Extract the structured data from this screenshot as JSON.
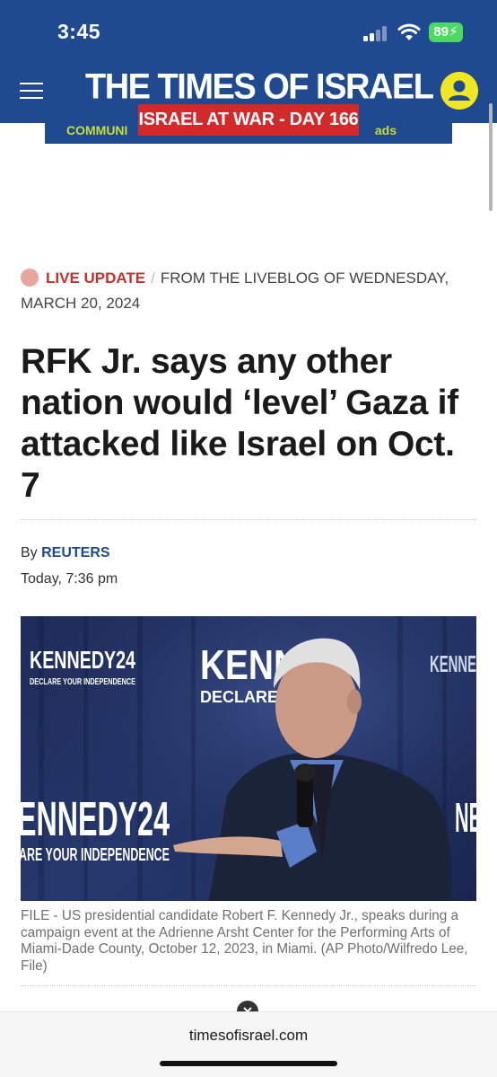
{
  "status_bar": {
    "time": "3:45",
    "battery": "89",
    "battery_color": "#4cd964"
  },
  "header": {
    "logo": "THE TIMES OF ISRAEL",
    "bg_color": "#1f4a8f",
    "menu_icon": "hamburger-menu-icon",
    "account_icon": "account-icon"
  },
  "banner": {
    "war_badge": "ISRAEL AT WAR - DAY 166",
    "badge_color": "#d22a2a",
    "ad_left": "COMMUNI",
    "ad_right": "ads"
  },
  "article": {
    "live_label": "LIVE UPDATE",
    "separator": "/",
    "liveblog": "FROM THE LIVEBLOG OF WEDNESDAY, MARCH 20, 2024",
    "headline": "RFK Jr. says any other nation would ‘level’ Gaza if attacked like Israel on Oct. 7",
    "by": "By",
    "author": "REUTERS",
    "date": "Today, 7:36 pm",
    "photo": {
      "sign_top_left": "KENNEDY24",
      "sign_top_left_sub": "DECLARE YOUR INDEPENDENCE",
      "sign_top_center": "KENN",
      "sign_top_center_sub": "DECLARE",
      "sign_top_right": "KENNE",
      "sign_bottom_left": "ENNEDY24",
      "sign_bottom_left_sub": "ARE YOUR INDEPENDENCE",
      "sign_bottom_right": "NE"
    },
    "caption": "FILE - US presidential candidate Robert F. Kennedy Jr., speaks during a campaign event at the Adrienne Arsht Center for the Performing Arts of Miami-Dade County, October 12, 2023, in Miami. (AP Photo/Wilfredo Lee, File)"
  },
  "browser": {
    "url": "timesofisrael.com"
  }
}
